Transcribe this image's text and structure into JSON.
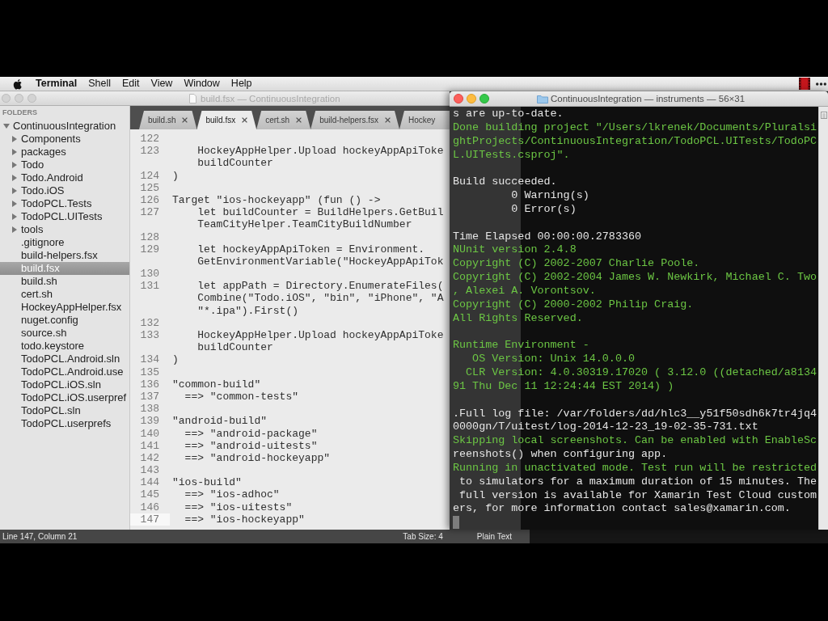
{
  "menu_bar": {
    "app_menu": "Terminal",
    "items": [
      "Shell",
      "Edit",
      "View",
      "Window",
      "Help"
    ]
  },
  "editor_window": {
    "title": "build.fsx — ContinuousIntegration",
    "sidebar": {
      "heading": "FOLDERS",
      "tree": [
        {
          "label": "ContinuousIntegration",
          "kind": "folder",
          "expanded": true,
          "selected": false,
          "children": [
            {
              "label": "Components",
              "kind": "folder",
              "expanded": false,
              "selected": false
            },
            {
              "label": "packages",
              "kind": "folder",
              "expanded": false,
              "selected": false
            },
            {
              "label": "Todo",
              "kind": "folder",
              "expanded": false,
              "selected": false
            },
            {
              "label": "Todo.Android",
              "kind": "folder",
              "expanded": false,
              "selected": false
            },
            {
              "label": "Todo.iOS",
              "kind": "folder",
              "expanded": false,
              "selected": false
            },
            {
              "label": "TodoPCL.Tests",
              "kind": "folder",
              "expanded": false,
              "selected": false
            },
            {
              "label": "TodoPCL.UITests",
              "kind": "folder",
              "expanded": false,
              "selected": false
            },
            {
              "label": "tools",
              "kind": "folder",
              "expanded": false,
              "selected": false
            },
            {
              "label": ".gitignore",
              "kind": "file",
              "selected": false
            },
            {
              "label": "build-helpers.fsx",
              "kind": "file",
              "selected": false
            },
            {
              "label": "build.fsx",
              "kind": "file",
              "selected": true
            },
            {
              "label": "build.sh",
              "kind": "file",
              "selected": false
            },
            {
              "label": "cert.sh",
              "kind": "file",
              "selected": false
            },
            {
              "label": "HockeyAppHelper.fsx",
              "kind": "file",
              "selected": false
            },
            {
              "label": "nuget.config",
              "kind": "file",
              "selected": false
            },
            {
              "label": "source.sh",
              "kind": "file",
              "selected": false
            },
            {
              "label": "todo.keystore",
              "kind": "file",
              "selected": false
            },
            {
              "label": "TodoPCL.Android.sln",
              "kind": "file",
              "selected": false
            },
            {
              "label": "TodoPCL.Android.use",
              "kind": "file",
              "selected": false
            },
            {
              "label": "TodoPCL.iOS.sln",
              "kind": "file",
              "selected": false
            },
            {
              "label": "TodoPCL.iOS.userpref",
              "kind": "file",
              "selected": false
            },
            {
              "label": "TodoPCL.sln",
              "kind": "file",
              "selected": false
            },
            {
              "label": "TodoPCL.userprefs",
              "kind": "file",
              "selected": false
            }
          ]
        }
      ]
    },
    "tabs": [
      {
        "label": "build.sh",
        "selected": false,
        "close_button": true
      },
      {
        "label": "build.fsx",
        "selected": true,
        "close_button": true
      },
      {
        "label": "cert.sh",
        "selected": false,
        "close_button": true
      },
      {
        "label": "build-helpers.fsx",
        "selected": false,
        "close_button": true
      },
      {
        "label": "Hockey",
        "selected": false,
        "close_button": false
      }
    ],
    "lines": [
      {
        "number": "122",
        "current": false
      },
      {
        "number": "123",
        "text": "    HockeyAppHelper.Upload hockeyAppApiToke",
        "wrap": [
          "    buildCounter"
        ],
        "current": false
      },
      {
        "number": "124",
        "text": ")",
        "current": false
      },
      {
        "number": "125",
        "current": false
      },
      {
        "number": "126",
        "text": "Target \"ios-hockeyapp\" (fun () ->",
        "current": false
      },
      {
        "number": "127",
        "text": "    let buildCounter = BuildHelpers.GetBuil",
        "wrap": [
          "    TeamCityHelper.TeamCityBuildNumber"
        ],
        "current": false
      },
      {
        "number": "128",
        "current": false
      },
      {
        "number": "129",
        "text": "    let hockeyAppApiToken = Environment.",
        "wrap": [
          "    GetEnvironmentVariable(\"HockeyAppApiTok"
        ],
        "current": false
      },
      {
        "number": "130",
        "current": false
      },
      {
        "number": "131",
        "text": "    let appPath = Directory.EnumerateFiles(",
        "wrap": [
          "    Combine(\"Todo.iOS\", \"bin\", \"iPhone\", \"A",
          "    \"*.ipa\").First()"
        ],
        "current": false
      },
      {
        "number": "132",
        "current": false
      },
      {
        "number": "133",
        "text": "    HockeyAppHelper.Upload hockeyAppApiToke",
        "wrap": [
          "    buildCounter"
        ],
        "current": false
      },
      {
        "number": "134",
        "text": ")",
        "current": false
      },
      {
        "number": "135",
        "current": false
      },
      {
        "number": "136",
        "text": "\"common-build\"",
        "current": false
      },
      {
        "number": "137",
        "text": "  ==> \"common-tests\"",
        "current": false
      },
      {
        "number": "138",
        "current": false
      },
      {
        "number": "139",
        "text": "\"android-build\"",
        "current": false
      },
      {
        "number": "140",
        "text": "  ==> \"android-package\"",
        "current": false
      },
      {
        "number": "141",
        "text": "  ==> \"android-uitests\"",
        "current": false
      },
      {
        "number": "142",
        "text": "  ==> \"android-hockeyapp\"",
        "current": false
      },
      {
        "number": "143",
        "current": false
      },
      {
        "number": "144",
        "text": "\"ios-build\"",
        "current": false
      },
      {
        "number": "145",
        "text": "  ==> \"ios-adhoc\"",
        "current": false
      },
      {
        "number": "146",
        "text": "  ==> \"ios-uitests\"",
        "current": false
      },
      {
        "number": "147",
        "text": "  ==> \"ios-hockeyapp\"",
        "current": true
      }
    ],
    "status_bar": {
      "position": "Line 147, Column 21",
      "tab_size": "Tab Size: 4",
      "syntax": "Plain Text"
    }
  },
  "terminal_window": {
    "title": "ContinuousIntegration — instruments — 56×31",
    "blocks": [
      {
        "lines": [
          {
            "text": "s are up-to-date.",
            "color": "#e6e6e6"
          },
          {
            "text": "Done building project \"/Users/lkrenek/Documents/Pluralsi",
            "color": "#6cc644"
          },
          {
            "text": "ghtProjects/ContinuousIntegration/TodoPCL.UITests/TodoPC",
            "color": "#6cc644"
          },
          {
            "text": "L.UITests.csproj\".",
            "color": "#6cc644"
          }
        ]
      },
      {
        "lines": [
          {
            "text": "Build succeeded.",
            "color": "#e6e6e6"
          },
          {
            "text": "         0 Warning(s)",
            "color": "#e6e6e6"
          },
          {
            "text": "         0 Error(s)",
            "color": "#e6e6e6"
          }
        ]
      },
      {
        "lines": [
          {
            "text": "Time Elapsed 00:00:00.2783360",
            "color": "#e6e6e6"
          },
          {
            "text": "NUnit version 2.4.8",
            "color": "#6cc644"
          },
          {
            "text": "Copyright (C) 2002-2007 Charlie Poole.",
            "color": "#6cc644"
          },
          {
            "text": "Copyright (C) 2002-2004 James W. Newkirk, Michael C. Two",
            "color": "#6cc644"
          },
          {
            "text": ", Alexei A. Vorontsov.",
            "color": "#6cc644"
          },
          {
            "text": "Copyright (C) 2000-2002 Philip Craig.",
            "color": "#6cc644"
          },
          {
            "text": "All Rights Reserved.",
            "color": "#6cc644"
          }
        ]
      },
      {
        "lines": [
          {
            "text": "Runtime Environment -",
            "color": "#6cc644"
          },
          {
            "text": "   OS Version: Unix 14.0.0.0",
            "color": "#6cc644"
          },
          {
            "text": "  CLR Version: 4.0.30319.17020 ( 3.12.0 ((detached/a8134",
            "color": "#6cc644"
          },
          {
            "text": "91 Thu Dec 11 12:24:44 EST 2014) )",
            "color": "#6cc644"
          }
        ]
      },
      {
        "lines": [
          {
            "text": ".Full log file: /var/folders/dd/hlc3__y51f50sdh6k7tr4jq4",
            "color": "#e6e6e6"
          },
          {
            "text": "0000gn/T/uitest/log-2014-12-23_19-02-35-731.txt",
            "color": "#e6e6e6"
          },
          {
            "text": "Skipping local screenshots. Can be enabled with EnableSc",
            "color": "#6cc644"
          },
          {
            "text": "reenshots() when configuring app.",
            "color": "#e6e6e6"
          },
          {
            "text": "Running in unactivated mode. Test run will be restricted",
            "color": "#6cc644"
          },
          {
            "text": " to simulators for a maximum duration of 15 minutes. The",
            "color": "#e6e6e6"
          },
          {
            "text": " full version is available for Xamarin Test Cloud custom",
            "color": "#e6e6e6"
          },
          {
            "text": "ers, for more information contact sales@xamarin.com.",
            "color": "#e6e6e6"
          }
        ]
      }
    ]
  }
}
